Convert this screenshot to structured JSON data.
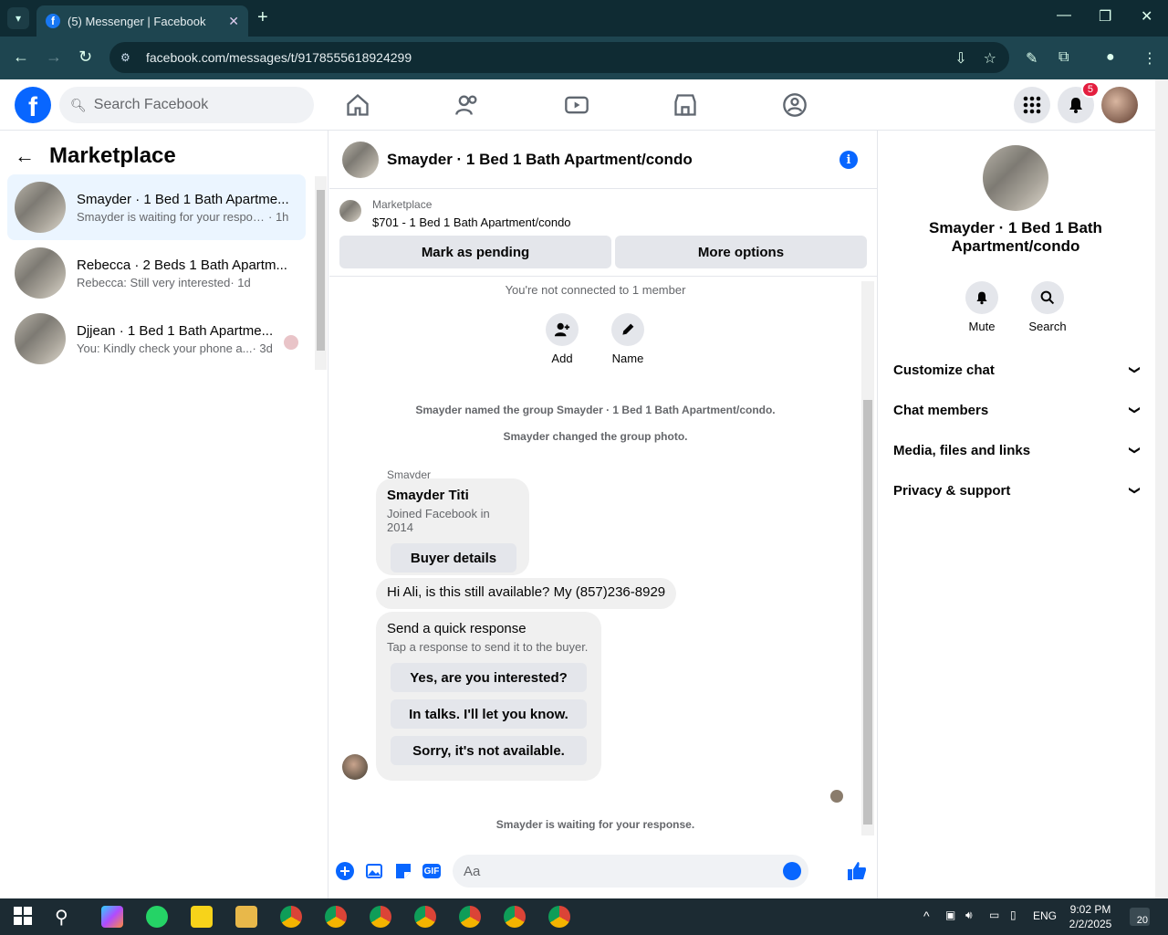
{
  "browser": {
    "tab_title": "(5) Messenger | Facebook",
    "url": "facebook.com/messages/t/9178555618924299"
  },
  "fb_header": {
    "search_placeholder": "Search Facebook",
    "notification_count": "5"
  },
  "sidebar": {
    "title": "Marketplace",
    "conversations": [
      {
        "name": "Smayder · 1 Bed 1 Bath Apartme...",
        "snippet": "Smayder is waiting for your respon...",
        "time": "· 1h",
        "active": true
      },
      {
        "name": "Rebecca · 2 Beds 1 Bath Apartm...",
        "snippet": "Rebecca: Still very interested",
        "time": "· 1d",
        "active": false
      },
      {
        "name": "Djjean · 1 Bed 1 Bath Apartme...",
        "snippet": "You: Kindly check your phone a...",
        "time": "· 3d",
        "active": false
      }
    ]
  },
  "chat": {
    "title": "Smayder · 1 Bed 1 Bath Apartment/condo",
    "listing_label": "Marketplace",
    "listing_price": "$701 - 1 Bed 1 Bath Apartment/condo",
    "mark_pending": "Mark as pending",
    "more_options": "More options",
    "not_connected": "You're not connected to 1 member",
    "add_label": "Add",
    "name_label": "Name",
    "event1": "Smayder named the group Smayder · 1 Bed 1 Bath Apartment/condo.",
    "event2": "Smayder changed the group photo.",
    "sender": "Smayder",
    "profile_name": "Smayder Titi",
    "profile_joined": "Joined Facebook in 2014",
    "buyer_details": "Buyer details",
    "message": "Hi Ali, is this still available? My  (857)236-8929",
    "quick_title": "Send a quick response",
    "quick_sub": "Tap a response to send it to the buyer.",
    "quick_replies": [
      "Yes, are you interested?",
      "In talks. I'll let you know.",
      "Sorry, it's not available."
    ],
    "waiting": "Smayder is waiting for your response.",
    "composer_placeholder": "Aa"
  },
  "details": {
    "name_line1": "Smayder · 1 Bed 1 Bath",
    "name_line2": "Apartment/condo",
    "mute": "Mute",
    "search": "Search",
    "sections": [
      "Customize chat",
      "Chat members",
      "Media, files and links",
      "Privacy & support"
    ]
  },
  "taskbar": {
    "lang": "ENG",
    "time": "9:02 PM",
    "date": "2/2/2025",
    "notif_count": "20"
  }
}
